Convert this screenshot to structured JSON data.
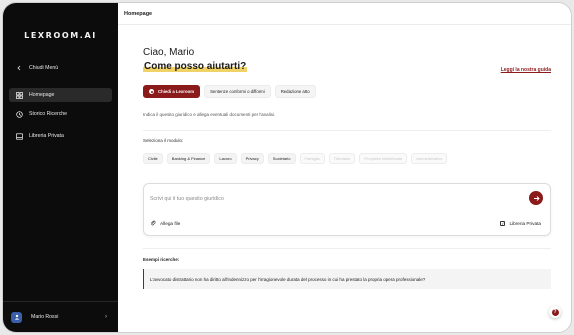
{
  "sidebar": {
    "logo": "LEXROOM.AI",
    "collapse_label": "Chiudi Menù",
    "items": [
      {
        "label": "Homepage",
        "icon": "home-icon",
        "active": true
      },
      {
        "label": "Storico Ricerche",
        "icon": "history-icon",
        "active": false
      },
      {
        "label": "Libreria Privata",
        "icon": "library-icon",
        "active": false
      }
    ],
    "user": {
      "name": "Mario Rossi"
    }
  },
  "header": {
    "title": "Homepage"
  },
  "main": {
    "greeting": "Ciao, Mario",
    "question": "Come posso aiutarti?",
    "guide_link": "Leggi la nostra guida",
    "modes": [
      {
        "label": "Chiedi a Lexroom",
        "active": true
      },
      {
        "label": "Sentenze conformi o difformi",
        "active": false
      },
      {
        "label": "Redazione atto",
        "active": false
      }
    ],
    "hint": "Indica il quesito giuridico e allega eventuali documenti per l'analisi.",
    "modules_label": "Seleziona il modulo:",
    "modules": [
      {
        "label": "Civile",
        "enabled": true
      },
      {
        "label": "Banking & Finance",
        "enabled": true
      },
      {
        "label": "Lavoro",
        "enabled": true
      },
      {
        "label": "Privacy",
        "enabled": true
      },
      {
        "label": "Societario",
        "enabled": true
      },
      {
        "label": "Famiglia",
        "enabled": false
      },
      {
        "label": "Tributario",
        "enabled": false
      },
      {
        "label": "Proprietà Intellettuale",
        "enabled": false
      },
      {
        "label": "Amministrativo",
        "enabled": false
      }
    ],
    "input": {
      "placeholder": "Scrivi qui il tuo quesito giuridico",
      "attach_label": "Allega file",
      "private_library_label": "Libreria Privata",
      "private_library_checked": true
    },
    "examples_label": "Esempi ricerche:",
    "example": "L'avvocato distrattario non ha diritto all'indennizzo per l'irragionevole durata del processo in cui ha prestato la propria opera professionale?"
  },
  "colors": {
    "accent": "#8b1a1a",
    "sidebar_bg": "#0c0c0c",
    "highlight": "#f1d266"
  }
}
